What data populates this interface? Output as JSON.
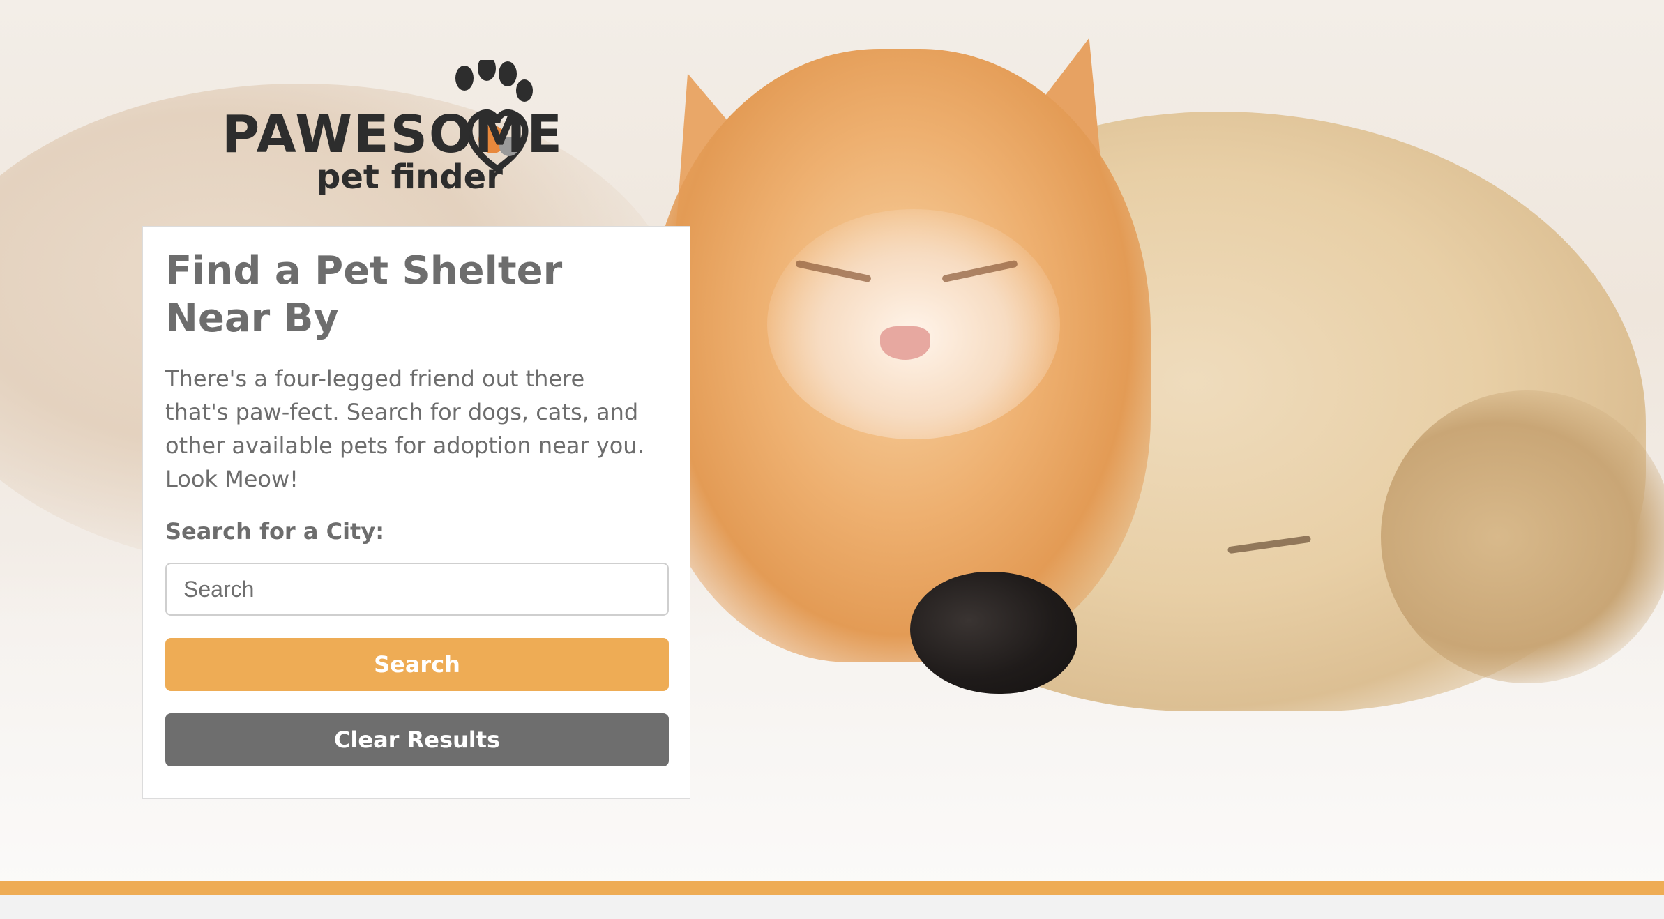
{
  "logo": {
    "main_text": "PAWESOME",
    "sub_text": "pet finder"
  },
  "card": {
    "title": "Find a Pet Shelter Near By",
    "description": "There's a four-legged friend out there that's paw-fect. Search for dogs, cats, and other available pets for adoption near you. Look Meow!",
    "search_label": "Search for a City:",
    "search_placeholder": "Search",
    "search_button": "Search",
    "clear_button": "Clear Results"
  },
  "colors": {
    "accent": "#EEAC55",
    "secondary_button": "#6E6E6E",
    "heading_text": "#6D6D6D",
    "card_background": "#FFFFFF"
  },
  "icons": {
    "logo_paw": "paw-print-icon",
    "logo_pets": "dog-cat-heart-icon"
  }
}
